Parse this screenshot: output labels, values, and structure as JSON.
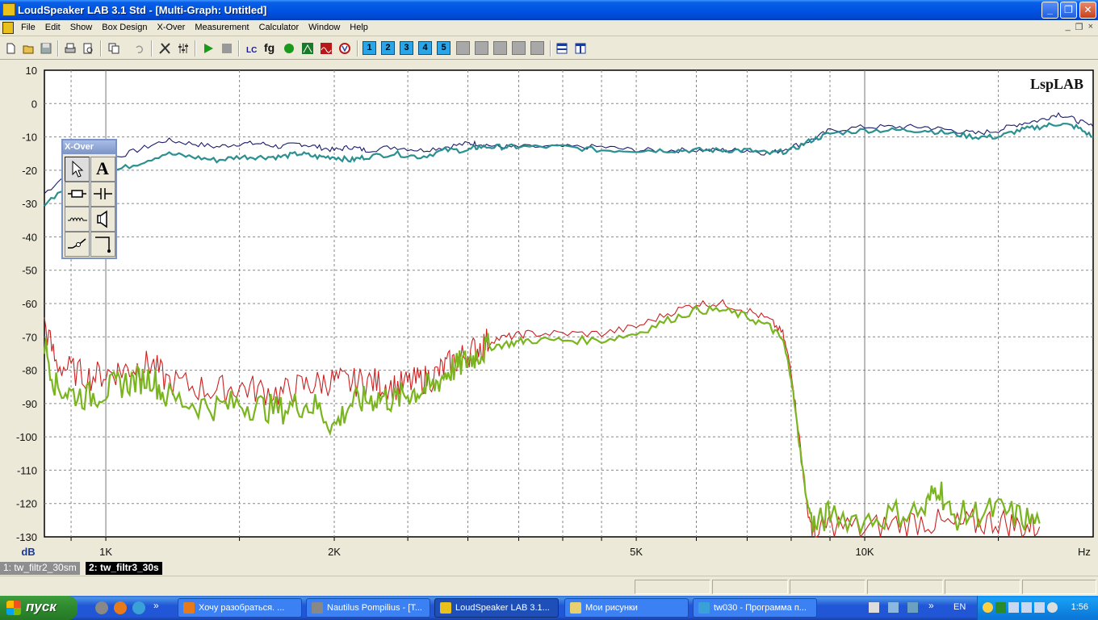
{
  "window": {
    "title": "LoudSpeaker LAB 3.1 Std - [Multi-Graph: Untitled]",
    "buttons": {
      "minimize": "_",
      "maximize": "❐",
      "close": "✕"
    }
  },
  "menu": {
    "items": [
      "File",
      "Edit",
      "Show",
      "Box Design",
      "X-Over",
      "Measurement",
      "Calculator",
      "Window",
      "Help"
    ],
    "mdi": {
      "minimize": "_",
      "restore": "❐",
      "close": "×"
    }
  },
  "toolbar": {
    "numbered_buttons": [
      "1",
      "2",
      "3",
      "4",
      "5"
    ],
    "fg_label": "fg"
  },
  "graph": {
    "brand": "LspLAB",
    "x_unit": "Hz",
    "y_unit": "dB",
    "y_ticks": [
      "10",
      "0",
      "-10",
      "-20",
      "-30",
      "-40",
      "-50",
      "-60",
      "-70",
      "-80",
      "-90",
      "-100",
      "-110",
      "-120",
      "-130"
    ],
    "x_tick_labels": [
      "1K",
      "2K",
      "5K",
      "10K"
    ]
  },
  "chart_data": {
    "type": "line",
    "title": "",
    "xlabel": "Hz",
    "ylabel": "dB",
    "x_scale": "log",
    "xlim": [
      830,
      20000
    ],
    "ylim": [
      -130,
      10
    ],
    "grid": true,
    "series": [
      {
        "name": "",
        "color": "#1c1c6c",
        "points": [
          [
            830,
            -27
          ],
          [
            900,
            -20
          ],
          [
            1000,
            -17
          ],
          [
            1100,
            -14
          ],
          [
            1200,
            -11
          ],
          [
            1300,
            -12
          ],
          [
            1400,
            -13
          ],
          [
            1500,
            -12
          ],
          [
            1600,
            -12
          ],
          [
            1700,
            -13
          ],
          [
            1800,
            -12
          ],
          [
            1900,
            -13
          ],
          [
            2000,
            -14
          ],
          [
            2100,
            -13
          ],
          [
            2200,
            -14
          ],
          [
            2400,
            -13
          ],
          [
            2600,
            -14
          ],
          [
            2800,
            -13
          ],
          [
            3000,
            -12
          ],
          [
            3100,
            -12
          ],
          [
            3300,
            -13
          ],
          [
            3500,
            -13
          ],
          [
            4000,
            -13
          ],
          [
            4500,
            -13
          ],
          [
            5000,
            -14
          ],
          [
            5500,
            -14
          ],
          [
            6000,
            -14
          ],
          [
            6500,
            -14
          ],
          [
            7000,
            -14
          ],
          [
            7500,
            -15
          ],
          [
            8000,
            -13
          ],
          [
            8500,
            -11
          ],
          [
            9000,
            -8
          ],
          [
            10000,
            -7
          ],
          [
            11000,
            -7
          ],
          [
            12000,
            -7
          ],
          [
            13000,
            -8
          ],
          [
            14000,
            -9
          ],
          [
            15000,
            -8
          ],
          [
            16000,
            -6
          ],
          [
            17000,
            -5
          ],
          [
            18000,
            -3
          ],
          [
            19000,
            -5
          ],
          [
            20000,
            -7
          ]
        ]
      },
      {
        "name": "",
        "color": "#2a9090",
        "points": [
          [
            830,
            -30
          ],
          [
            900,
            -24
          ],
          [
            1000,
            -21
          ],
          [
            1100,
            -18
          ],
          [
            1200,
            -15
          ],
          [
            1300,
            -16
          ],
          [
            1400,
            -17
          ],
          [
            1500,
            -16
          ],
          [
            1600,
            -16
          ],
          [
            1700,
            -16
          ],
          [
            1800,
            -15
          ],
          [
            1900,
            -16
          ],
          [
            2000,
            -16
          ],
          [
            2100,
            -17
          ],
          [
            2200,
            -16
          ],
          [
            2400,
            -15
          ],
          [
            2600,
            -16
          ],
          [
            2800,
            -14
          ],
          [
            3000,
            -14
          ],
          [
            3100,
            -13
          ],
          [
            3300,
            -13
          ],
          [
            3500,
            -13
          ],
          [
            4000,
            -13
          ],
          [
            4500,
            -14
          ],
          [
            5000,
            -14
          ],
          [
            5500,
            -14
          ],
          [
            6000,
            -14
          ],
          [
            6500,
            -14
          ],
          [
            7000,
            -14
          ],
          [
            7500,
            -15
          ],
          [
            8000,
            -14
          ],
          [
            8500,
            -11
          ],
          [
            9000,
            -9
          ],
          [
            10000,
            -8
          ],
          [
            11000,
            -8
          ],
          [
            12000,
            -8
          ],
          [
            13000,
            -9
          ],
          [
            14000,
            -10
          ],
          [
            15000,
            -10
          ],
          [
            16000,
            -8
          ],
          [
            17000,
            -7
          ],
          [
            18000,
            -6
          ],
          [
            19000,
            -7
          ],
          [
            20000,
            -10
          ]
        ]
      },
      {
        "name": "",
        "color": "#cc2020",
        "points": [
          [
            830,
            -66
          ],
          [
            860,
            -78
          ],
          [
            900,
            -80
          ],
          [
            950,
            -82
          ],
          [
            1000,
            -81
          ],
          [
            1050,
            -80
          ],
          [
            1100,
            -79
          ],
          [
            1150,
            -78
          ],
          [
            1200,
            -83
          ],
          [
            1300,
            -85
          ],
          [
            1400,
            -86
          ],
          [
            1500,
            -85
          ],
          [
            1600,
            -86
          ],
          [
            1700,
            -87
          ],
          [
            1800,
            -85
          ],
          [
            1900,
            -84
          ],
          [
            2000,
            -83
          ],
          [
            2100,
            -84
          ],
          [
            2200,
            -83
          ],
          [
            2300,
            -84
          ],
          [
            2400,
            -85
          ],
          [
            2500,
            -84
          ],
          [
            2600,
            -83
          ],
          [
            2700,
            -82
          ],
          [
            2800,
            -79
          ],
          [
            2900,
            -77
          ],
          [
            3000,
            -75
          ],
          [
            3100,
            -73
          ],
          [
            3200,
            -71
          ],
          [
            3400,
            -70
          ],
          [
            3600,
            -69
          ],
          [
            4000,
            -69
          ],
          [
            4500,
            -69
          ],
          [
            5000,
            -67
          ],
          [
            5500,
            -63
          ],
          [
            6000,
            -60
          ],
          [
            6500,
            -60
          ],
          [
            7000,
            -62
          ],
          [
            7500,
            -65
          ],
          [
            7800,
            -69
          ],
          [
            8000,
            -80
          ],
          [
            8200,
            -100
          ],
          [
            8400,
            -122
          ],
          [
            8600,
            -130
          ],
          [
            9000,
            -126
          ],
          [
            10000,
            -128
          ],
          [
            11000,
            -126
          ],
          [
            12000,
            -125
          ],
          [
            13000,
            -127
          ],
          [
            14000,
            -126
          ],
          [
            15000,
            -125
          ],
          [
            16000,
            -127
          ],
          [
            17000,
            -127
          ]
        ]
      },
      {
        "name": "",
        "color": "#7ab520",
        "points": [
          [
            830,
            -72
          ],
          [
            860,
            -85
          ],
          [
            900,
            -87
          ],
          [
            950,
            -88
          ],
          [
            1000,
            -86
          ],
          [
            1050,
            -84
          ],
          [
            1100,
            -83
          ],
          [
            1150,
            -82
          ],
          [
            1200,
            -88
          ],
          [
            1300,
            -90
          ],
          [
            1400,
            -91
          ],
          [
            1500,
            -90
          ],
          [
            1600,
            -91
          ],
          [
            1700,
            -92
          ],
          [
            1800,
            -90
          ],
          [
            1900,
            -91
          ],
          [
            2000,
            -97
          ],
          [
            2100,
            -90
          ],
          [
            2200,
            -89
          ],
          [
            2300,
            -88
          ],
          [
            2400,
            -89
          ],
          [
            2500,
            -87
          ],
          [
            2600,
            -86
          ],
          [
            2700,
            -85
          ],
          [
            2800,
            -81
          ],
          [
            2900,
            -79
          ],
          [
            3000,
            -77
          ],
          [
            3100,
            -75
          ],
          [
            3200,
            -73
          ],
          [
            3400,
            -72
          ],
          [
            3600,
            -71
          ],
          [
            4000,
            -71
          ],
          [
            4500,
            -71
          ],
          [
            5000,
            -69
          ],
          [
            5500,
            -65
          ],
          [
            6000,
            -62
          ],
          [
            6500,
            -62
          ],
          [
            7000,
            -64
          ],
          [
            7500,
            -67
          ],
          [
            7800,
            -71
          ],
          [
            8000,
            -82
          ],
          [
            8200,
            -102
          ],
          [
            8400,
            -120
          ],
          [
            8600,
            -127
          ],
          [
            9000,
            -123
          ],
          [
            10000,
            -125
          ],
          [
            11000,
            -123
          ],
          [
            12000,
            -122
          ],
          [
            12500,
            -114
          ],
          [
            13000,
            -124
          ],
          [
            14000,
            -123
          ],
          [
            15000,
            -122
          ],
          [
            16000,
            -124
          ],
          [
            17000,
            -126
          ]
        ]
      }
    ]
  },
  "xover_palette": {
    "title": "X-Over",
    "text_tool": "A"
  },
  "tabs": [
    {
      "label": "1: tw_filtr2_30sm",
      "active": false
    },
    {
      "label": "2: tw_filtr3_30s",
      "active": true
    }
  ],
  "taskbar": {
    "start_label": "пуск",
    "tasks": [
      {
        "label": "Хочу разобраться. ...",
        "icon": "firefox-icon",
        "active": false
      },
      {
        "label": "Nautilus Pompilius - [T...",
        "icon": "player-icon",
        "active": false
      },
      {
        "label": "LoudSpeaker LAB 3.1...",
        "icon": "lsplab-icon",
        "active": true
      },
      {
        "label": "Мои рисунки",
        "icon": "folder-icon",
        "active": false
      },
      {
        "label": "tw030 - Программа п...",
        "icon": "image-viewer-icon",
        "active": false
      }
    ],
    "language": "EN",
    "clock": "1:56"
  }
}
